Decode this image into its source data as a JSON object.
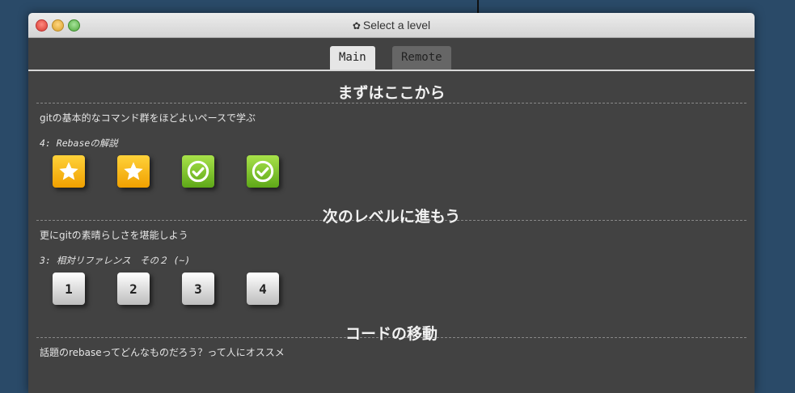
{
  "window": {
    "title": "Select a level"
  },
  "tabs": [
    {
      "label": "Main",
      "active": true
    },
    {
      "label": "Remote",
      "active": false
    }
  ],
  "sections": [
    {
      "title": "まずはここから",
      "description": "gitの基本的なコマンド群をほどよいペースで学ぶ",
      "level_name": "4: Rebaseの解説",
      "levels": [
        {
          "status": "star",
          "icon": "star-icon"
        },
        {
          "status": "star",
          "icon": "star-icon"
        },
        {
          "status": "completed",
          "icon": "checkmark-icon"
        },
        {
          "status": "completed",
          "icon": "checkmark-icon"
        }
      ]
    },
    {
      "title": "次のレベルに進もう",
      "description": "更にgitの素晴らしさを堪能しよう",
      "level_name": "3: 相対リファレンス　その２ (~)",
      "levels": [
        {
          "label": "1"
        },
        {
          "label": "2"
        },
        {
          "label": "3"
        },
        {
          "label": "4"
        }
      ]
    },
    {
      "title": "コードの移動",
      "description": "話題のrebaseってどんなものだろう？って人にオススメ"
    }
  ],
  "colors": {
    "window_bg": "#424242",
    "desktop_bg": "#2a4a68",
    "star_tile": "#f0a000",
    "check_tile": "#5ea818"
  }
}
